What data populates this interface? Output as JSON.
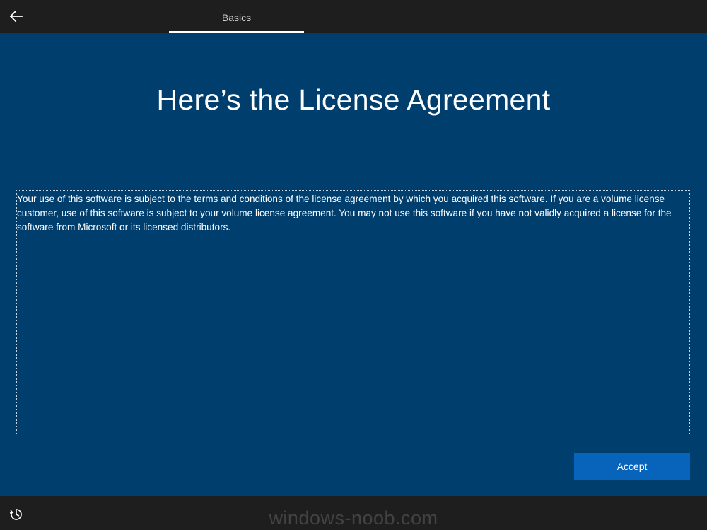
{
  "header": {
    "back_icon": "arrow-left-icon",
    "tab_label": "Basics"
  },
  "main": {
    "title": "Here’s the License Agreement",
    "license_text": "Your use of this software is subject to the terms and conditions of the license agreement by which you acquired this software. If you are a volume license customer, use of this software is subject to your volume license agreement. You may not use this software if you have not validly acquired a license for the software from Microsoft or its licensed distributors.",
    "accept_label": "Accept"
  },
  "footer": {
    "ease_icon": "ease-of-access-icon",
    "watermark": "windows-noob.com"
  },
  "colors": {
    "background": "#003e6e",
    "bars": "#1e1e1e",
    "accent": "#0864bb",
    "text": "#ffffff"
  }
}
